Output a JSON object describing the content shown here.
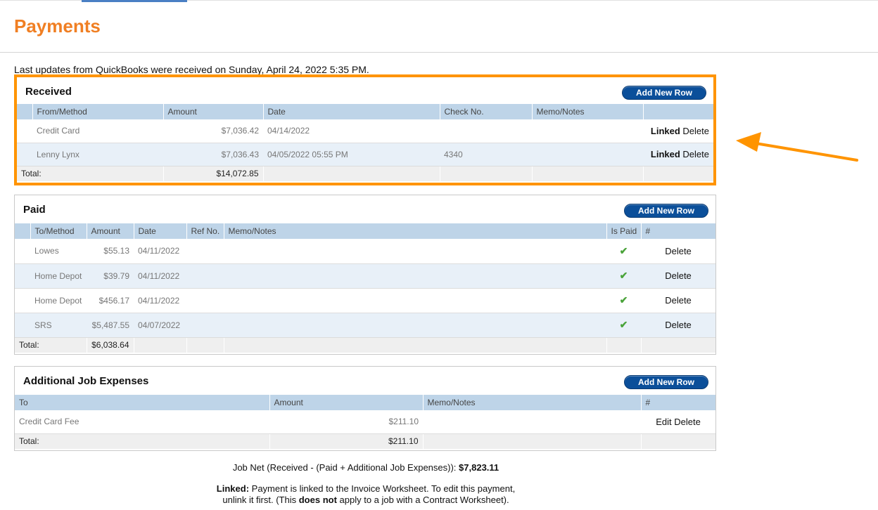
{
  "page": {
    "title": "Payments",
    "qb_note": "Last updates from QuickBooks were received on Sunday, April 24, 2022 5:35 PM."
  },
  "colors": {
    "title": "#f07f23",
    "highlight": "#ff9400",
    "button": "#0b4f9a",
    "header": "#bed4e8",
    "check": "#4aa33a"
  },
  "received": {
    "title": "Received",
    "add_label": "Add New Row",
    "headers": [
      "From/Method",
      "Amount",
      "Date",
      "Check No.",
      "Memo/Notes",
      ""
    ],
    "rows": [
      {
        "from": "Credit Card",
        "amount": "$7,036.42",
        "date": "04/14/2022",
        "check": "",
        "memo": "",
        "linked": "Linked",
        "delete": "Delete"
      },
      {
        "from": "Lenny Lynx",
        "amount": "$7,036.43",
        "date": "04/05/2022 05:55 PM",
        "check": "4340",
        "memo": "",
        "linked": "Linked",
        "delete": "Delete"
      }
    ],
    "total_label": "Total:",
    "total_amount": "$14,072.85"
  },
  "paid": {
    "title": "Paid",
    "add_label": "Add New Row",
    "headers": [
      "To/Method",
      "Amount",
      "Date",
      "Ref No.",
      "Memo/Notes",
      "Is Paid",
      "#"
    ],
    "rows": [
      {
        "to": "Lowes",
        "amount": "$55.13",
        "date": "04/11/2022",
        "ref": "",
        "memo": "",
        "delete": "Delete"
      },
      {
        "to": "Home Depot",
        "amount": "$39.79",
        "date": "04/11/2022",
        "ref": "",
        "memo": "",
        "delete": "Delete"
      },
      {
        "to": "Home Depot",
        "amount": "$456.17",
        "date": "04/11/2022",
        "ref": "",
        "memo": "",
        "delete": "Delete"
      },
      {
        "to": "SRS",
        "amount": "$5,487.55",
        "date": "04/07/2022",
        "ref": "",
        "memo": "",
        "delete": "Delete"
      }
    ],
    "check_icon": "checkmark-icon",
    "total_label": "Total:",
    "total_amount": "$6,038.64"
  },
  "expenses": {
    "title": "Additional Job Expenses",
    "add_label": "Add New Row",
    "headers": [
      "To",
      "Amount",
      "Memo/Notes",
      "#"
    ],
    "rows": [
      {
        "to": "Credit Card Fee",
        "amount": "$211.10",
        "memo": "",
        "edit": "Edit",
        "delete": "Delete"
      }
    ],
    "total_label": "Total:",
    "total_amount": "$211.10"
  },
  "footer": {
    "job_net_label": "Job Net (Received - (Paid + Additional Job Expenses)):",
    "job_net_value": "$7,823.11",
    "linked_bold": "Linked:",
    "linked_text_1": "Payment is linked to the Invoice Worksheet. To edit this payment,",
    "linked_text_2": "unlink it first. (This",
    "linked_does_not": "does not",
    "linked_text_3": "apply to a job with a Contract Worksheet)."
  }
}
